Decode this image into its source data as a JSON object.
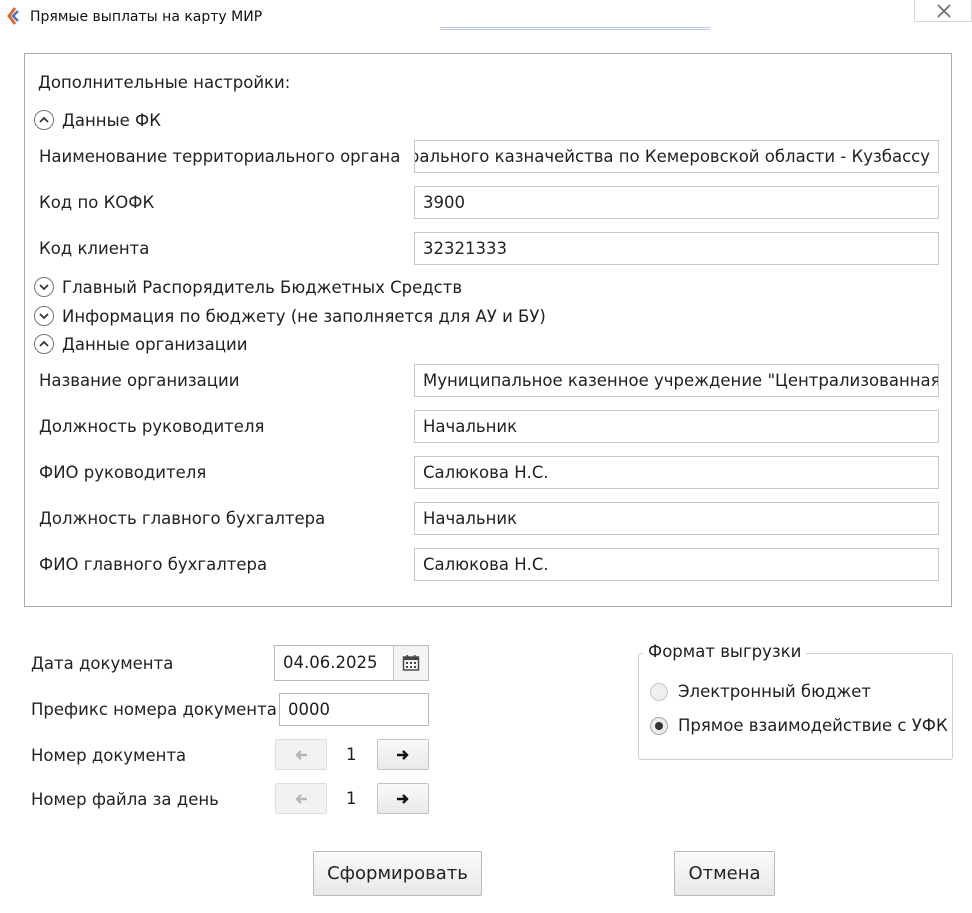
{
  "window": {
    "title": "Прямые выплаты на карту МИР",
    "accent_color": "#e8682a"
  },
  "settings": {
    "heading": "Дополнительные настройки:",
    "sections": {
      "fk": {
        "label": "Данные ФК",
        "state": "expanded"
      },
      "grbs": {
        "label": "Главный Распорядитель Бюджетных Средств",
        "state": "collapsed"
      },
      "budget": {
        "label": "Информация по бюджету (не заполняется для АУ и БУ)",
        "state": "collapsed"
      },
      "org": {
        "label": "Данные организации",
        "state": "expanded"
      }
    },
    "fk_fields": [
      {
        "label": "Наименование территориального органа",
        "value": "Управление Федерального казначейства по Кемеровской области - Кузбассу"
      },
      {
        "label": "Код по КОФК",
        "value": "3900"
      },
      {
        "label": "Код клиента",
        "value": "32321333"
      }
    ],
    "org_fields": [
      {
        "label": "Название организации",
        "value": "Муниципальное казенное учреждение \"Централизованная бухгалтерия\""
      },
      {
        "label": "Должность руководителя",
        "value": "Начальник"
      },
      {
        "label": "ФИО руководителя",
        "value": "Салюкова Н.С."
      },
      {
        "label": "Должность главного бухгалтера",
        "value": "Начальник"
      },
      {
        "label": "ФИО главного бухгалтера",
        "value": "Салюкова Н.С."
      }
    ]
  },
  "document": {
    "date_label": "Дата документа",
    "date_value": "04.06.2025",
    "prefix_label": "Префикс номера документа",
    "prefix_value": "0000",
    "number_label": "Номер документа",
    "number_value": "1",
    "file_label": "Номер файла за день",
    "file_value": "1"
  },
  "export_format": {
    "legend": "Формат выгрузки",
    "options": [
      {
        "label": "Электронный бюджет",
        "selected": false
      },
      {
        "label": "Прямое взаимодействие с УФК",
        "selected": true
      }
    ]
  },
  "actions": {
    "submit_label": "Сформировать",
    "cancel_label": "Отмена"
  },
  "icons": {
    "logo": "app-logo-icon",
    "close": "close-icon",
    "expand": "chevron-up-icon",
    "collapse": "chevron-down-icon",
    "calendar": "calendar-icon",
    "prev": "arrow-left-icon",
    "next": "arrow-right-icon"
  }
}
